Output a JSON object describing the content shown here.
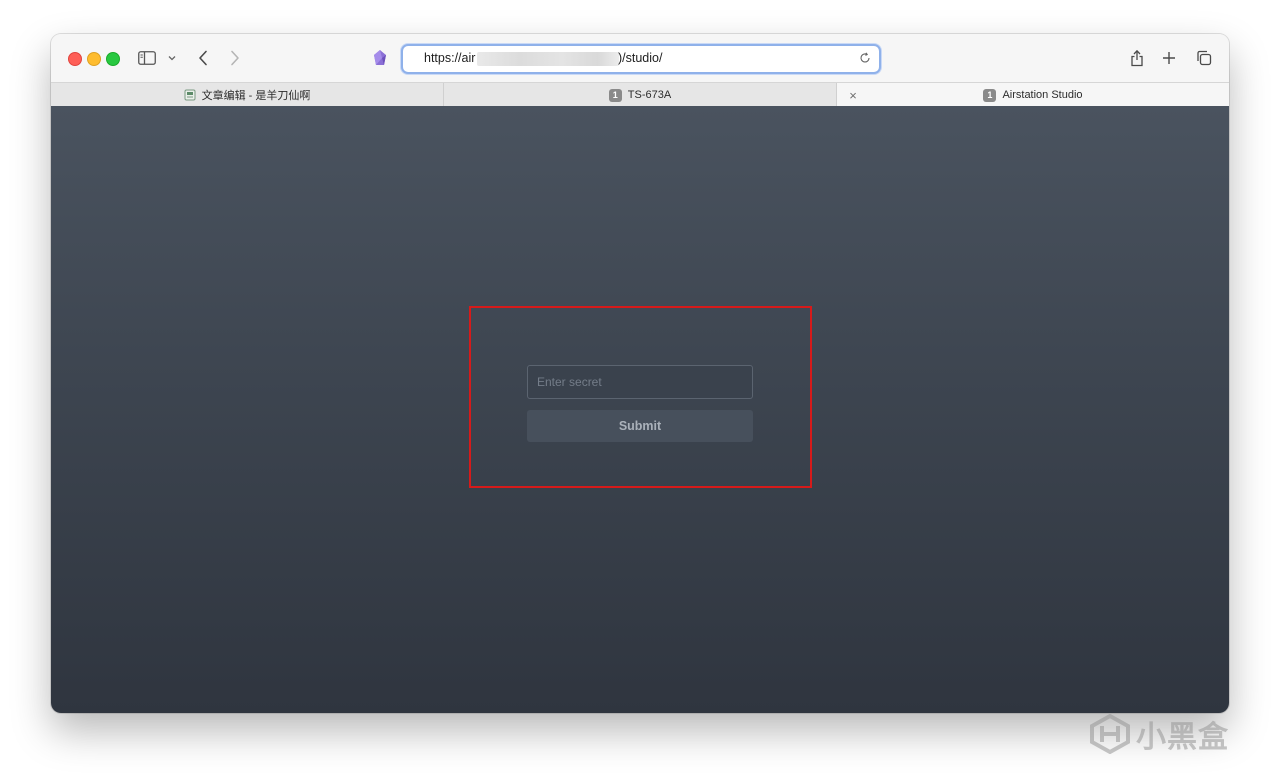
{
  "browser": {
    "url_prefix": "https://air",
    "url_suffix": ")/studio/",
    "url_full_visible": "https://air…)/studio/",
    "address_focused_color": "#8fb1ea"
  },
  "toolbar": {
    "icons": [
      "sidebar-icon",
      "chevron-down-icon",
      "back-arrow-icon",
      "forward-arrow-icon",
      "extension-icon",
      "reload-icon",
      "share-icon",
      "plus-icon",
      "tabs-overview-icon"
    ]
  },
  "tabs": [
    {
      "label": "文章编辑 - 是羊刀仙啊",
      "favicon": "doc-icon",
      "active": false
    },
    {
      "label": "TS-673A",
      "badge": "1",
      "active": false
    },
    {
      "label": "Airstation Studio",
      "badge": "1",
      "active": true,
      "close_label": "×"
    }
  ],
  "form": {
    "secret_placeholder": "Enter secret",
    "secret_value": "",
    "submit_label": "Submit"
  },
  "annotation": {
    "highlight_color": "#d61a1a"
  },
  "watermark": {
    "text": "小黑盒"
  }
}
